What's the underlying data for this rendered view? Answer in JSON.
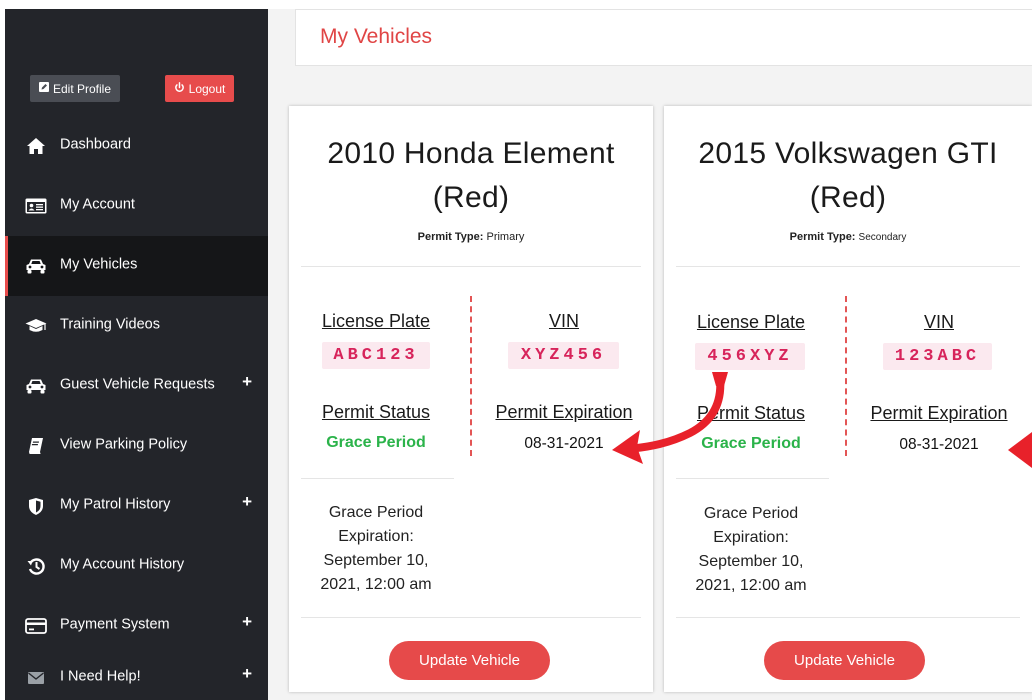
{
  "sidebar": {
    "edit_profile_label": "Edit Profile",
    "logout_label": "Logout",
    "items": [
      {
        "label": "Dashboard",
        "icon": "home-icon",
        "has_plus": false
      },
      {
        "label": "My Account",
        "icon": "id-card-icon",
        "has_plus": false
      },
      {
        "label": "My Vehicles",
        "icon": "car-icon",
        "has_plus": false,
        "active": true
      },
      {
        "label": "Training Videos",
        "icon": "graduation-cap-icon",
        "has_plus": false
      },
      {
        "label": "Guest Vehicle Requests",
        "icon": "car-icon",
        "has_plus": true
      },
      {
        "label": "View Parking Policy",
        "icon": "book-icon",
        "has_plus": false
      },
      {
        "label": "My Patrol History",
        "icon": "shield-icon",
        "has_plus": true
      },
      {
        "label": "My Account History",
        "icon": "history-icon",
        "has_plus": false
      },
      {
        "label": "Payment System",
        "icon": "credit-card-icon",
        "has_plus": true
      },
      {
        "label": "I Need Help!",
        "icon": "envelope-icon",
        "has_plus": true
      }
    ],
    "plus_glyph": "+"
  },
  "header": {
    "title": "My Vehicles"
  },
  "labels": {
    "permit_type": "Permit Type:",
    "license_plate": "License Plate",
    "vin": "VIN",
    "permit_status": "Permit Status",
    "permit_expiration": "Permit Expiration",
    "update_button": "Update Vehicle"
  },
  "vehicles": [
    {
      "name_line1": "2010 Honda Element",
      "name_line2": "(Red)",
      "permit_type": "Primary",
      "license_plate": "ABC123",
      "vin": "XYZ456",
      "permit_status": "Grace Period",
      "permit_expiration": "08-31-2021",
      "grace_lines": [
        "Grace Period",
        "Expiration:",
        "September 10,",
        "2021, 12:00 am"
      ]
    },
    {
      "name_line1": "2015 Volkswagen GTI",
      "name_line2": "(Red)",
      "permit_type": "Secondary",
      "license_plate": "456XYZ",
      "vin": "123ABC",
      "permit_status": "Grace Period",
      "permit_expiration": "08-31-2021",
      "grace_lines": [
        "Grace Period",
        "Expiration:",
        "September 10,",
        "2021, 12:00 am"
      ]
    }
  ],
  "colors": {
    "accent": "#e74c4c",
    "sidebar_bg": "#23252a",
    "status_green": "#2bb34a",
    "plate_text": "#d7245b",
    "plate_bg": "#fbe9ef",
    "annotation_arrow": "#e8212a"
  }
}
